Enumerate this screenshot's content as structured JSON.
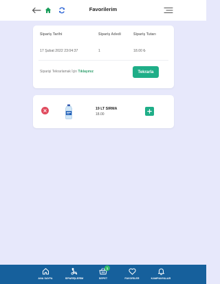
{
  "header": {
    "title": "Favorilerim",
    "back_icon": "arrow-left-icon",
    "home_icon": "home-icon",
    "refresh_icon": "refresh-icon",
    "menu_icon": "menu-icon",
    "home_color": "#1a9e5b",
    "refresh_color": "#2f66d6"
  },
  "order": {
    "columns": [
      "Sipariş Tarihi",
      "Sipariş Adedi",
      "Sipariş Tutarı"
    ],
    "values": [
      "17 Şubat 2022 23:04:37",
      "1",
      "18.00 ₺"
    ],
    "repeat_text": "Siparişi Tekrarlamak İçin",
    "repeat_link": "Tıklayınız",
    "repeat_button": "Tekrarla"
  },
  "favorites": [
    {
      "name": "19 LT SIRMA",
      "price": "18.00",
      "remove_icon": "close-icon",
      "add_icon": "plus-icon",
      "image": "water-bottle-image"
    }
  ],
  "bottom_nav": {
    "items": [
      {
        "label": "ANA SAYFA",
        "icon": "home-icon"
      },
      {
        "label": "SİPARİŞLERİM",
        "icon": "delivery-icon"
      },
      {
        "label": "SEPET",
        "icon": "basket-icon",
        "badge": "1"
      },
      {
        "label": "FAVORİLER",
        "icon": "heart-icon"
      },
      {
        "label": "KAMPANYALAR",
        "icon": "bell-icon"
      }
    ]
  },
  "colors": {
    "background": "#e7e8fb",
    "accent": "#1fae88",
    "nav_bar": "#16609c",
    "danger": "#e04b5e",
    "badge": "#2fb86a"
  }
}
